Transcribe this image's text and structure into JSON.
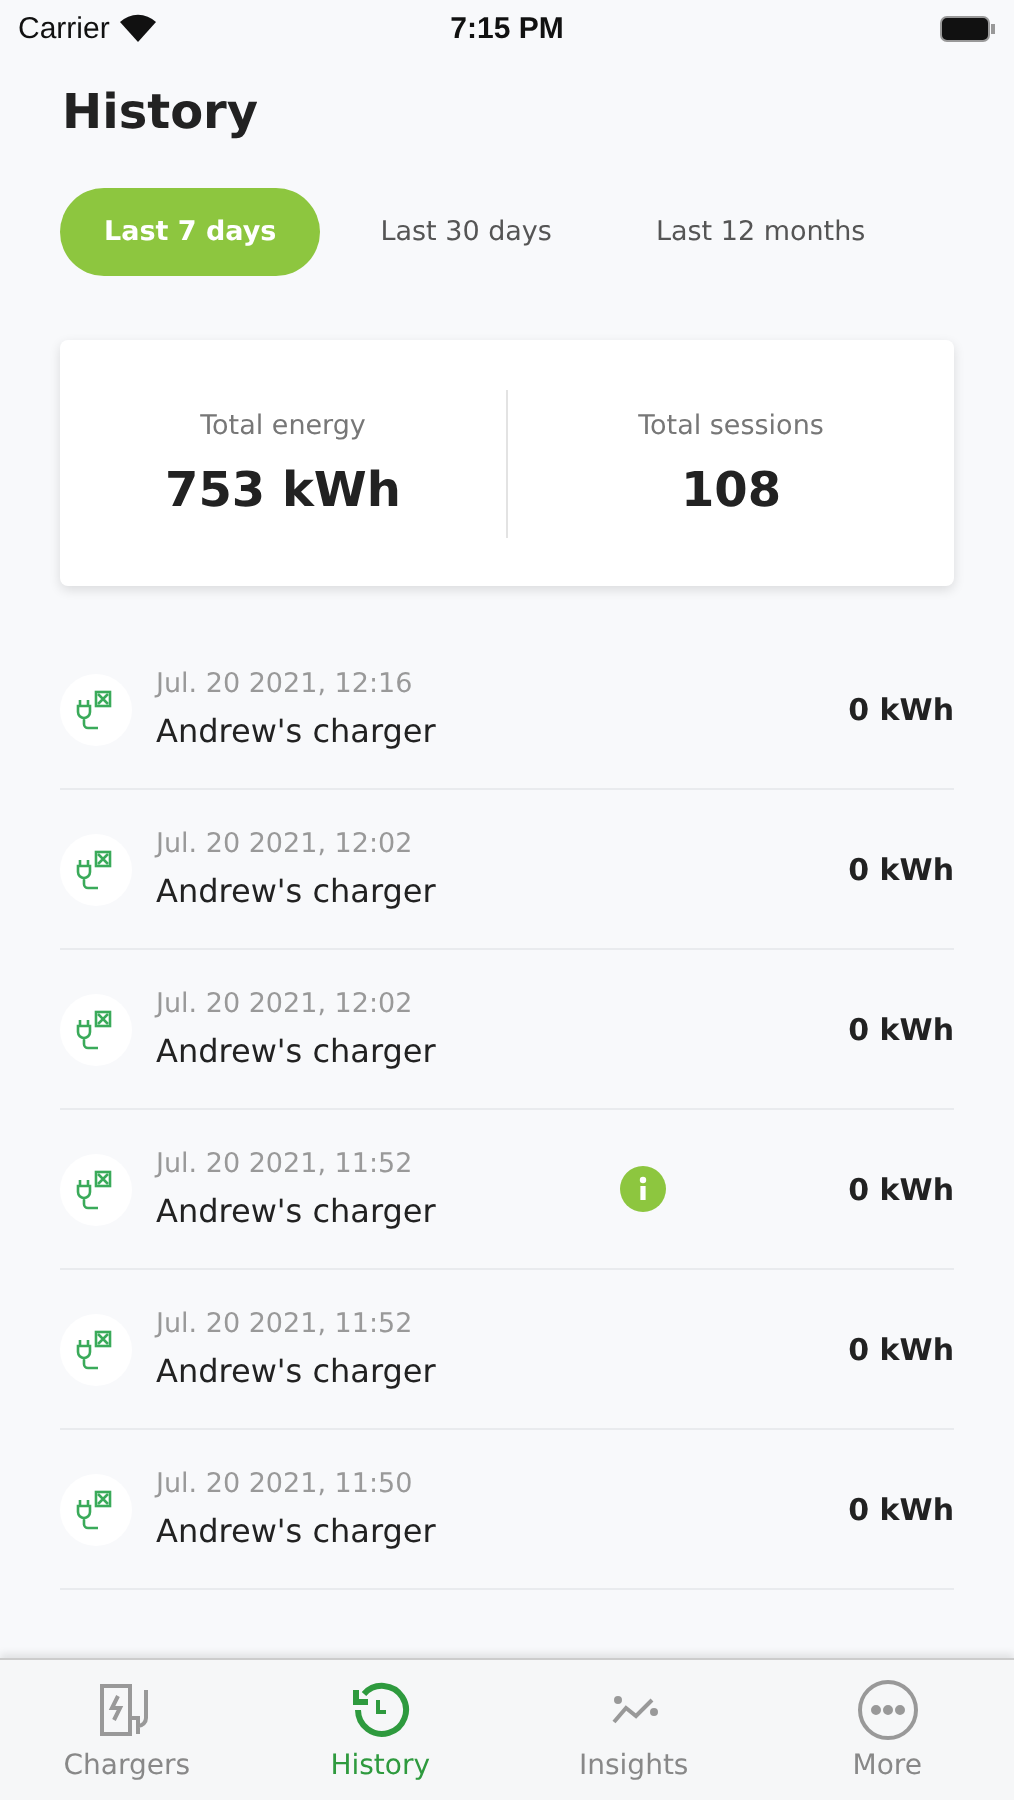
{
  "status_bar": {
    "carrier": "Carrier",
    "time": "7:15 PM"
  },
  "title": "History",
  "period_tabs": [
    {
      "label": "Last 7 days",
      "selected": true
    },
    {
      "label": "Last 30 days",
      "selected": false
    },
    {
      "label": "Last 12 months",
      "selected": false
    }
  ],
  "summary": [
    {
      "label": "Total energy",
      "value": "753 kWh"
    },
    {
      "label": "Total sessions",
      "value": "108"
    }
  ],
  "sessions": [
    {
      "date": "Jul. 20 2021, 12:16",
      "charger": "Andrew's charger",
      "energy": "0 kWh",
      "info": false
    },
    {
      "date": "Jul. 20 2021, 12:02",
      "charger": "Andrew's charger",
      "energy": "0 kWh",
      "info": false
    },
    {
      "date": "Jul. 20 2021, 12:02",
      "charger": "Andrew's charger",
      "energy": "0 kWh",
      "info": false
    },
    {
      "date": "Jul. 20 2021, 11:52",
      "charger": "Andrew's charger",
      "energy": "0 kWh",
      "info": true
    },
    {
      "date": "Jul. 20 2021, 11:52",
      "charger": "Andrew's charger",
      "energy": "0 kWh",
      "info": false
    },
    {
      "date": "Jul. 20 2021, 11:50",
      "charger": "Andrew's charger",
      "energy": "0 kWh",
      "info": false
    }
  ],
  "tab_bar": [
    {
      "label": "Chargers",
      "kind": "chargers",
      "selected": false
    },
    {
      "label": "History",
      "kind": "history",
      "selected": true
    },
    {
      "label": "Insights",
      "kind": "insights",
      "selected": false
    },
    {
      "label": "More",
      "kind": "more",
      "selected": false
    }
  ]
}
